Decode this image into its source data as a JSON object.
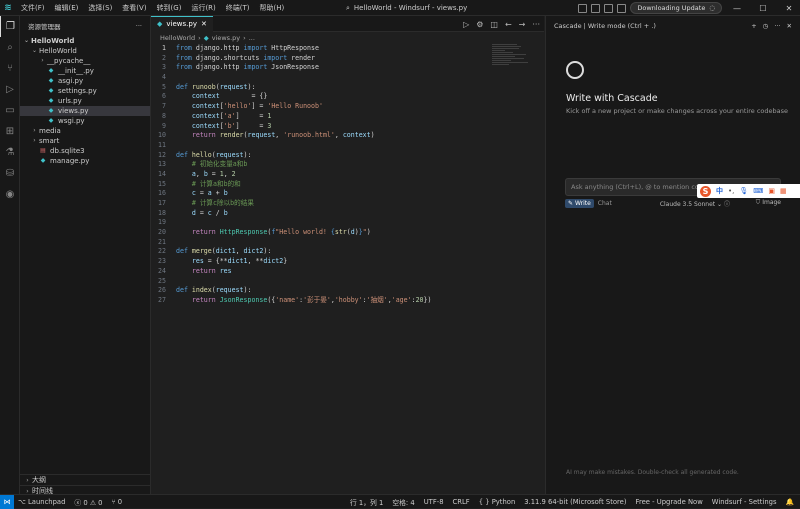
{
  "titlebar": {
    "menus": [
      "文件(F)",
      "编辑(E)",
      "选择(S)",
      "查看(V)",
      "转到(G)",
      "运行(R)",
      "终端(T)",
      "帮助(H)"
    ],
    "search_text": "HelloWorld - Windsurf - views.py",
    "update_label": "Downloading Update"
  },
  "sidebar": {
    "header": "资源管理器",
    "root": "HelloWorld",
    "tree": [
      {
        "label": "HelloWorld",
        "depth": 1,
        "type": "folder",
        "open": true
      },
      {
        "label": "__pycache__",
        "depth": 2,
        "type": "folder",
        "open": false
      },
      {
        "label": "__init__.py",
        "depth": 2,
        "type": "py"
      },
      {
        "label": "asgi.py",
        "depth": 2,
        "type": "py"
      },
      {
        "label": "settings.py",
        "depth": 2,
        "type": "py"
      },
      {
        "label": "urls.py",
        "depth": 2,
        "type": "py"
      },
      {
        "label": "views.py",
        "depth": 2,
        "type": "py",
        "selected": true
      },
      {
        "label": "wsgi.py",
        "depth": 2,
        "type": "py"
      },
      {
        "label": "media",
        "depth": 1,
        "type": "folder",
        "open": false
      },
      {
        "label": "smart",
        "depth": 1,
        "type": "folder",
        "open": false
      },
      {
        "label": "db.sqlite3",
        "depth": 1,
        "type": "db"
      },
      {
        "label": "manage.py",
        "depth": 1,
        "type": "py"
      }
    ],
    "outline": "大纲",
    "timeline": "时间线"
  },
  "editor": {
    "tab_label": "views.py",
    "breadcrumb": [
      "HelloWorld",
      "views.py",
      "..."
    ],
    "current_line": 1,
    "lines": [
      [
        [
          "k",
          "from "
        ],
        [
          "ct",
          "django.http "
        ],
        [
          "k",
          "import "
        ],
        [
          "ct",
          "HttpResponse"
        ]
      ],
      [
        [
          "k",
          "from "
        ],
        [
          "ct",
          "django.shortcuts "
        ],
        [
          "k",
          "import "
        ],
        [
          "ct",
          "render"
        ]
      ],
      [
        [
          "k",
          "from "
        ],
        [
          "ct",
          "django.http "
        ],
        [
          "k",
          "import "
        ],
        [
          "ct",
          "JsonResponse"
        ]
      ],
      [],
      [
        [
          "k",
          "def "
        ],
        [
          "f",
          "runoob"
        ],
        [
          "ct",
          "("
        ],
        [
          "v",
          "request"
        ],
        [
          "ct",
          "):"
        ]
      ],
      [
        [
          "ct",
          "    "
        ],
        [
          "v",
          "context"
        ],
        [
          "ct",
          "        = {}"
        ]
      ],
      [
        [
          "ct",
          "    "
        ],
        [
          "v",
          "context"
        ],
        [
          "ct",
          "["
        ],
        [
          "s",
          "'hello'"
        ],
        [
          "ct",
          "] = "
        ],
        [
          "s",
          "'Hello Runoob'"
        ]
      ],
      [
        [
          "ct",
          "    "
        ],
        [
          "v",
          "context"
        ],
        [
          "ct",
          "["
        ],
        [
          "s",
          "'a'"
        ],
        [
          "ct",
          "]     = "
        ],
        [
          "n",
          "1"
        ]
      ],
      [
        [
          "ct",
          "    "
        ],
        [
          "v",
          "context"
        ],
        [
          "ct",
          "["
        ],
        [
          "s",
          "'b'"
        ],
        [
          "ct",
          "]     = "
        ],
        [
          "n",
          "3"
        ]
      ],
      [
        [
          "ct",
          "    "
        ],
        [
          "kw",
          "return "
        ],
        [
          "f",
          "render"
        ],
        [
          "ct",
          "("
        ],
        [
          "v",
          "request"
        ],
        [
          "ct",
          ", "
        ],
        [
          "s",
          "'runoob.html'"
        ],
        [
          "ct",
          ", "
        ],
        [
          "v",
          "context"
        ],
        [
          "ct",
          ")"
        ]
      ],
      [],
      [
        [
          "k",
          "def "
        ],
        [
          "f",
          "hello"
        ],
        [
          "ct",
          "("
        ],
        [
          "v",
          "request"
        ],
        [
          "ct",
          "):"
        ]
      ],
      [
        [
          "ct",
          "    "
        ],
        [
          "c",
          "# 初始化变量a和b"
        ]
      ],
      [
        [
          "ct",
          "    "
        ],
        [
          "v",
          "a"
        ],
        [
          "ct",
          ", "
        ],
        [
          "v",
          "b"
        ],
        [
          "ct",
          " = "
        ],
        [
          "n",
          "1"
        ],
        [
          "ct",
          ", "
        ],
        [
          "n",
          "2"
        ]
      ],
      [
        [
          "ct",
          "    "
        ],
        [
          "c",
          "# 计算a和b的和"
        ]
      ],
      [
        [
          "ct",
          "    "
        ],
        [
          "v",
          "c"
        ],
        [
          "ct",
          " = "
        ],
        [
          "v",
          "a"
        ],
        [
          "ct",
          " + "
        ],
        [
          "v",
          "b"
        ]
      ],
      [
        [
          "ct",
          "    "
        ],
        [
          "c",
          "# 计算c除以b的结果"
        ]
      ],
      [
        [
          "ct",
          "    "
        ],
        [
          "v",
          "d"
        ],
        [
          "ct",
          " = "
        ],
        [
          "v",
          "c"
        ],
        [
          "ct",
          " / "
        ],
        [
          "v",
          "b"
        ]
      ],
      [],
      [
        [
          "ct",
          "    "
        ],
        [
          "kw",
          "return "
        ],
        [
          "cl",
          "HttpResponse"
        ],
        [
          "ct",
          "("
        ],
        [
          "k",
          "f"
        ],
        [
          "s",
          "\"Hello world! "
        ],
        [
          "k",
          "{"
        ],
        [
          "f",
          "str"
        ],
        [
          "ct",
          "("
        ],
        [
          "v",
          "d"
        ],
        [
          "ct",
          ")"
        ],
        [
          "k",
          "}"
        ],
        [
          "s",
          "\""
        ],
        [
          "ct",
          ")"
        ]
      ],
      [],
      [
        [
          "k",
          "def "
        ],
        [
          "f",
          "merge"
        ],
        [
          "ct",
          "("
        ],
        [
          "v",
          "dict1"
        ],
        [
          "ct",
          ", "
        ],
        [
          "v",
          "dict2"
        ],
        [
          "ct",
          "):"
        ]
      ],
      [
        [
          "ct",
          "    "
        ],
        [
          "v",
          "res"
        ],
        [
          "ct",
          " = {**"
        ],
        [
          "v",
          "dict1"
        ],
        [
          "ct",
          ", **"
        ],
        [
          "v",
          "dict2"
        ],
        [
          "ct",
          "}"
        ]
      ],
      [
        [
          "ct",
          "    "
        ],
        [
          "kw",
          "return "
        ],
        [
          "v",
          "res"
        ]
      ],
      [],
      [
        [
          "k",
          "def "
        ],
        [
          "f",
          "index"
        ],
        [
          "ct",
          "("
        ],
        [
          "v",
          "request"
        ],
        [
          "ct",
          "):"
        ]
      ],
      [
        [
          "ct",
          "    "
        ],
        [
          "kw",
          "return "
        ],
        [
          "cl",
          "JsonResponse"
        ],
        [
          "ct",
          "({"
        ],
        [
          "s",
          "'name'"
        ],
        [
          "ct",
          ":"
        ],
        [
          "s",
          "'彭于晏'"
        ],
        [
          "ct",
          ","
        ],
        [
          "s",
          "'hobby'"
        ],
        [
          "ct",
          ":"
        ],
        [
          "s",
          "'抽烟'"
        ],
        [
          "ct",
          ","
        ],
        [
          "s",
          "'age'"
        ],
        [
          "ct",
          ":"
        ],
        [
          "n",
          "20"
        ],
        [
          "ct",
          "})"
        ]
      ]
    ]
  },
  "cascade": {
    "header": "Cascade | Write mode (Ctrl + .)",
    "title": "Write with Cascade",
    "subtitle": "Kick off a new project or make changes across your entire codebase",
    "input_placeholder": "Ask anything (Ctrl+L), @ to mention code blocks",
    "write_label": "Write",
    "chat_label": "Chat",
    "model": "Claude 3.5 Sonnet",
    "image_label": "Image",
    "disclaimer": "AI may make mistakes. Double-check all generated code.",
    "ime_label": "中"
  },
  "status": {
    "launchpad": "Launchpad",
    "errors": "0",
    "warnings": "0",
    "ports": "0",
    "position": "行 1，列 1",
    "indent": "空格: 4",
    "encoding": "UTF-8",
    "eol": "CRLF",
    "language": "Python",
    "interpreter": "3.11.9 64-bit (Microsoft Store)",
    "upgrade": "Free - Upgrade Now",
    "settings": "Windsurf - Settings"
  },
  "colors": {
    "accent": "#3fc1c9",
    "status_remote": "#0078d4"
  }
}
